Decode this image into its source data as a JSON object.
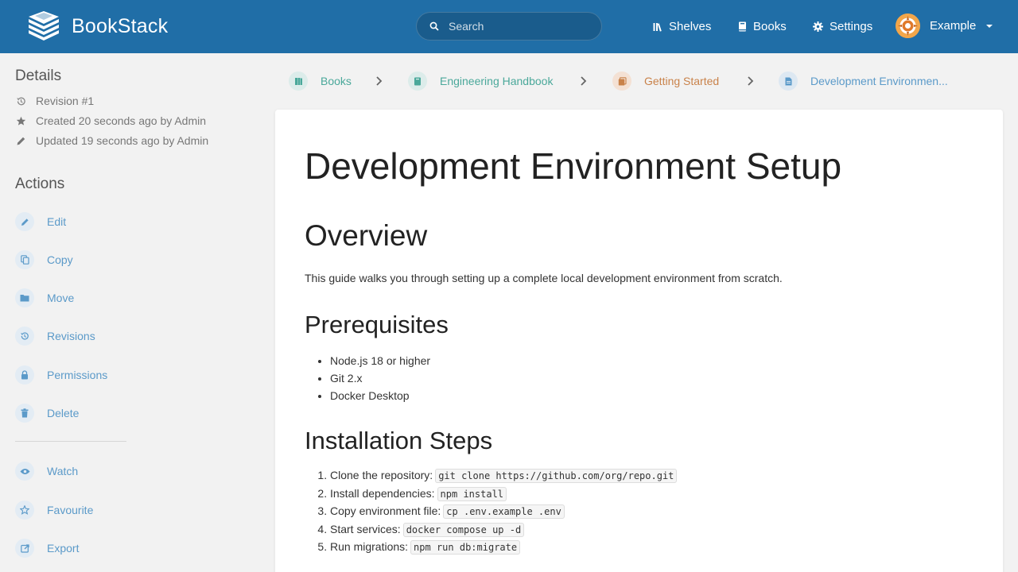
{
  "app": {
    "name": "BookStack"
  },
  "header": {
    "search_placeholder": "Search",
    "nav": [
      {
        "label": "Shelves",
        "icon": "shelves-icon"
      },
      {
        "label": "Books",
        "icon": "books-icon"
      },
      {
        "label": "Settings",
        "icon": "gear-icon"
      }
    ],
    "user": {
      "name": "Example"
    }
  },
  "sidebar": {
    "details_heading": "Details",
    "details": [
      {
        "text": "Revision #1",
        "icon": "history-icon"
      },
      {
        "text": "Created 20 seconds ago by Admin",
        "icon": "star-icon"
      },
      {
        "text": "Updated 19 seconds ago by Admin",
        "icon": "pencil-icon"
      }
    ],
    "actions_heading": "Actions",
    "actions": [
      {
        "label": "Edit",
        "icon": "edit-icon"
      },
      {
        "label": "Copy",
        "icon": "copy-icon"
      },
      {
        "label": "Move",
        "icon": "folder-icon"
      },
      {
        "label": "Revisions",
        "icon": "history-icon"
      },
      {
        "label": "Permissions",
        "icon": "lock-icon"
      },
      {
        "label": "Delete",
        "icon": "trash-icon"
      }
    ],
    "secondary_actions": [
      {
        "label": "Watch",
        "icon": "eye-icon"
      },
      {
        "label": "Favourite",
        "icon": "star-outline-icon"
      },
      {
        "label": "Export",
        "icon": "export-icon"
      }
    ]
  },
  "breadcrumbs": [
    {
      "label": "Books",
      "color": "#4aa89a"
    },
    {
      "label": "Engineering Handbook",
      "color": "#4aa89a"
    },
    {
      "label": "Getting Started",
      "color": "#c9824a"
    },
    {
      "label": "Development Environmen...",
      "color": "#5b9ac9"
    }
  ],
  "page": {
    "title": "Development Environment Setup",
    "overview_heading": "Overview",
    "overview_text": "This guide walks you through setting up a complete local development environment from scratch.",
    "prereq_heading": "Prerequisites",
    "prerequisites": [
      "Node.js 18 or higher",
      "Git 2.x",
      "Docker Desktop"
    ],
    "install_heading": "Installation Steps",
    "steps": [
      {
        "text": "Clone the repository:",
        "code": "git clone https://github.com/org/repo.git"
      },
      {
        "text": "Install dependencies:",
        "code": "npm install"
      },
      {
        "text": "Copy environment file:",
        "code": "cp .env.example .env"
      },
      {
        "text": "Start services:",
        "code": "docker compose up -d"
      },
      {
        "text": "Run migrations:",
        "code": "npm run db:migrate"
      }
    ]
  },
  "colors": {
    "header": "#206ea7",
    "action_link": "#5b9ac9",
    "book": "#4aa89a",
    "chapter": "#c9824a",
    "page": "#5b9ac9"
  }
}
